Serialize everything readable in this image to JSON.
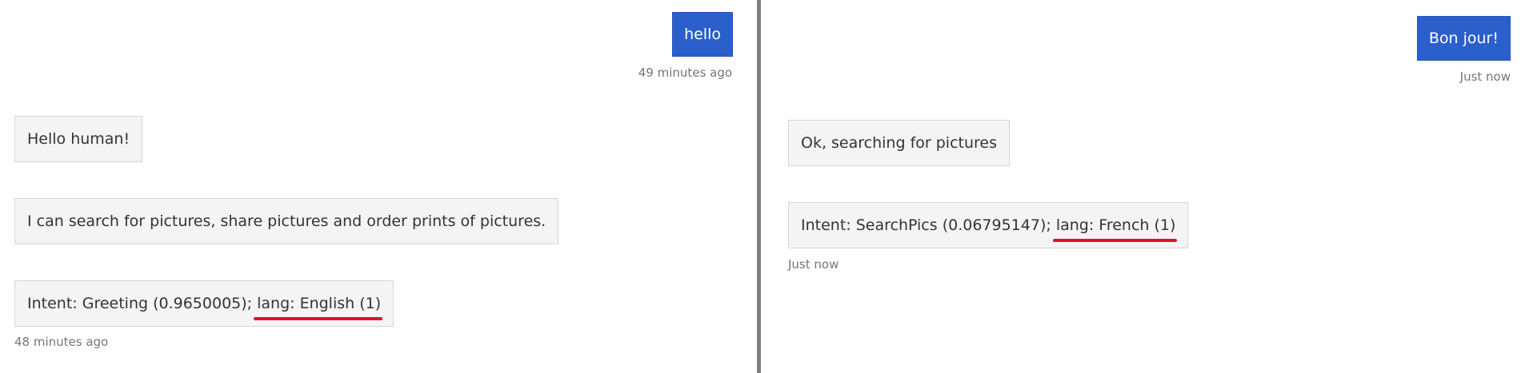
{
  "left_chat": {
    "user_message": {
      "text": "hello",
      "timestamp": "49 minutes ago"
    },
    "bot_messages": [
      {
        "text": "Hello human!"
      },
      {
        "text": "I can search for pictures, share pictures and order prints of pictures."
      },
      {
        "intent_text": "Intent: Greeting (0.9650005); ",
        "lang_text": "lang: English (1)"
      }
    ],
    "bot_timestamp": "48 minutes ago"
  },
  "right_chat": {
    "user_message": {
      "text": "Bon jour!",
      "timestamp": "Just now"
    },
    "bot_messages": [
      {
        "text": "Ok, searching for pictures"
      },
      {
        "intent_text": "Intent: SearchPics (0.06795147); ",
        "lang_text": "lang: French (1)"
      }
    ],
    "bot_timestamp": "Just now"
  },
  "colors": {
    "user_bubble": "#2b5fcc",
    "bot_bubble": "#f4f4f4",
    "divider": "#808080",
    "highlight_underline": "#e0102e"
  }
}
